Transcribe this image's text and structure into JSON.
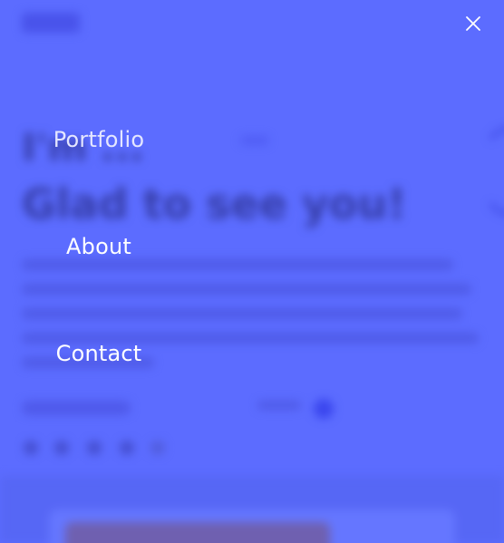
{
  "background": {
    "heading_line_1": "I'm ...",
    "heading_line_2": "Glad to see you!",
    "accent_color": "#5c6cff"
  },
  "menu": {
    "items": [
      {
        "label": "Portfolio"
      },
      {
        "label": "About"
      },
      {
        "label": "Contact"
      }
    ],
    "close_icon": "close-icon",
    "text_color": "#ffffff"
  }
}
